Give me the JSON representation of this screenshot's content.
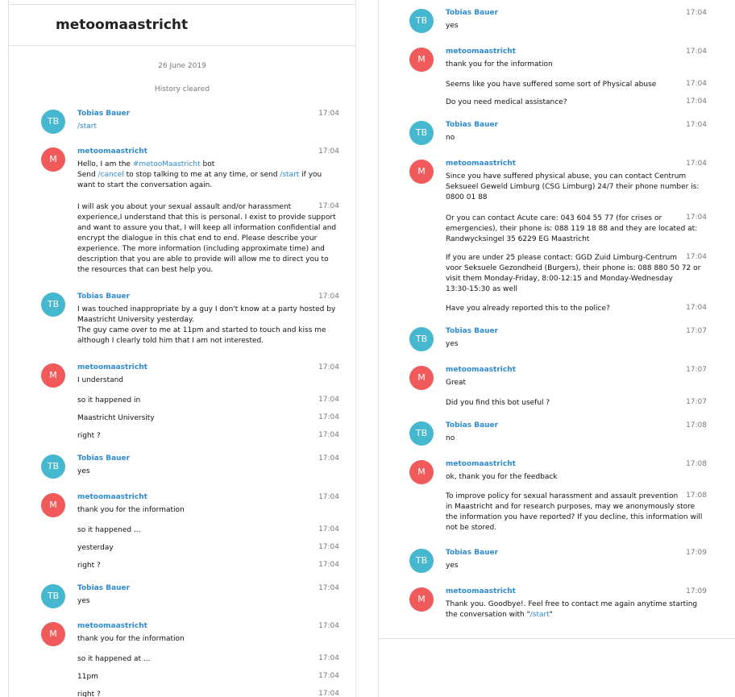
{
  "chat": {
    "title": "metoomaastricht",
    "date": "26 June 2019",
    "system_note": "History cleared"
  },
  "left": [
    {
      "sender": "Tobias Bauer",
      "avatar": "TB",
      "time": "17:04",
      "lines": [
        {
          "segments": [
            {
              "text": "/start",
              "link": true
            }
          ]
        }
      ]
    },
    {
      "sender": "metoomaastricht",
      "avatar": "M",
      "time": "17:04",
      "lines": [
        {
          "segments": [
            {
              "text": "Hello, I am the "
            },
            {
              "text": "#metooMaastricht",
              "link": true
            },
            {
              "text": " bot"
            }
          ]
        },
        {
          "segments": [
            {
              "text": "Send "
            },
            {
              "text": "/cancel",
              "link": true
            },
            {
              "text": " to stop talking to me at any time, or send "
            },
            {
              "text": "/start",
              "link": true
            },
            {
              "text": " if you"
            }
          ]
        },
        {
          "segments": [
            {
              "text": "want to start the conversation again."
            }
          ]
        }
      ]
    },
    {
      "sender": "",
      "time": "17:04",
      "lines": [
        {
          "segments": [
            {
              "text": "I will ask you about your sexual assault and/or harassment"
            }
          ]
        },
        {
          "segments": [
            {
              "text": "experience,I understand that this is personal. I exist to provide support"
            }
          ]
        },
        {
          "segments": [
            {
              "text": "and want to assure you that, I will keep all information confidential and"
            }
          ]
        },
        {
          "segments": [
            {
              "text": "encrypt the dialogue in this chat end to end. Please describe your"
            }
          ]
        },
        {
          "segments": [
            {
              "text": "experience. The more information (including approximate time) and"
            }
          ]
        },
        {
          "segments": [
            {
              "text": "description that you are able to provide will allow me to direct you to"
            }
          ]
        },
        {
          "segments": [
            {
              "text": "the resources that can best help you."
            }
          ]
        }
      ]
    },
    {
      "sender": "Tobias Bauer",
      "avatar": "TB",
      "time": "17:04",
      "lines": [
        {
          "segments": [
            {
              "text": "I was touched inappropriate by a guy I don't know at a party hosted by"
            }
          ]
        },
        {
          "segments": [
            {
              "text": "Maastricht University yesterday."
            }
          ]
        },
        {
          "segments": [
            {
              "text": "The guy came over to me at 11pm and started to touch and kiss me"
            }
          ]
        },
        {
          "segments": [
            {
              "text": "although I clearly told him that I am not interested."
            }
          ]
        }
      ]
    },
    {
      "sender": "metoomaastricht",
      "avatar": "M",
      "time": "17:04",
      "lines": [
        {
          "segments": [
            {
              "text": "I understand"
            }
          ]
        }
      ]
    },
    {
      "sender": "",
      "time": "17:04",
      "lines": [
        {
          "segments": [
            {
              "text": "so it happened in"
            }
          ]
        }
      ]
    },
    {
      "sender": "",
      "time": "17:04",
      "lines": [
        {
          "segments": [
            {
              "text": "Maastricht University"
            }
          ]
        }
      ]
    },
    {
      "sender": "",
      "time": "17:04",
      "lines": [
        {
          "segments": [
            {
              "text": "right ?"
            }
          ]
        }
      ]
    },
    {
      "sender": "Tobias Bauer",
      "avatar": "TB",
      "time": "17:04",
      "lines": [
        {
          "segments": [
            {
              "text": "yes"
            }
          ]
        }
      ]
    },
    {
      "sender": "metoomaastricht",
      "avatar": "M",
      "time": "17:04",
      "lines": [
        {
          "segments": [
            {
              "text": "thank you for the information"
            }
          ]
        }
      ]
    },
    {
      "sender": "",
      "time": "17:04",
      "lines": [
        {
          "segments": [
            {
              "text": "so it happened ..."
            }
          ]
        }
      ]
    },
    {
      "sender": "",
      "time": "17:04",
      "lines": [
        {
          "segments": [
            {
              "text": "yesterday"
            }
          ]
        }
      ]
    },
    {
      "sender": "",
      "time": "17:04",
      "lines": [
        {
          "segments": [
            {
              "text": "right ?"
            }
          ]
        }
      ]
    },
    {
      "sender": "Tobias Bauer",
      "avatar": "TB",
      "time": "17:04",
      "lines": [
        {
          "segments": [
            {
              "text": "yes"
            }
          ]
        }
      ]
    },
    {
      "sender": "metoomaastricht",
      "avatar": "M",
      "time": "17:04",
      "lines": [
        {
          "segments": [
            {
              "text": "thank you for the information"
            }
          ]
        }
      ]
    },
    {
      "sender": "",
      "time": "17:04",
      "lines": [
        {
          "segments": [
            {
              "text": "so it happened at ..."
            }
          ]
        }
      ]
    },
    {
      "sender": "",
      "time": "17:04",
      "lines": [
        {
          "segments": [
            {
              "text": "11pm"
            }
          ]
        }
      ]
    },
    {
      "sender": "",
      "time": "17:04",
      "lines": [
        {
          "segments": [
            {
              "text": "right ?"
            }
          ]
        }
      ]
    }
  ],
  "right": [
    {
      "sender": "Tobias Bauer",
      "avatar": "TB",
      "time": "17:04",
      "lines": [
        {
          "segments": [
            {
              "text": "yes"
            }
          ]
        }
      ]
    },
    {
      "sender": "metoomaastricht",
      "avatar": "M",
      "time": "17:04",
      "lines": [
        {
          "segments": [
            {
              "text": "thank you for the information"
            }
          ]
        }
      ]
    },
    {
      "sender": "",
      "time": "17:04",
      "lines": [
        {
          "segments": [
            {
              "text": "Seems like you have suffered some sort of Physical abuse"
            }
          ]
        }
      ]
    },
    {
      "sender": "",
      "time": "17:04",
      "lines": [
        {
          "segments": [
            {
              "text": "Do you need medical assistance?"
            }
          ]
        }
      ]
    },
    {
      "sender": "Tobias Bauer",
      "avatar": "TB",
      "time": "17:04",
      "lines": [
        {
          "segments": [
            {
              "text": "no"
            }
          ]
        }
      ]
    },
    {
      "sender": "metoomaastricht",
      "avatar": "M",
      "time": "17:04",
      "lines": [
        {
          "segments": [
            {
              "text": "Since you have suffered physical abuse, you can contact Centrum"
            }
          ]
        },
        {
          "segments": [
            {
              "text": "Seksueel Geweld Limburg (CSG Limburg) 24/7 their phone number is:"
            }
          ]
        },
        {
          "segments": [
            {
              "text": "0800 01 88"
            }
          ]
        }
      ]
    },
    {
      "sender": "",
      "time": "17:04",
      "lines": [
        {
          "segments": [
            {
              "text": "Or you can contact Acute care: 043 604 55 77 (for crises or"
            }
          ]
        },
        {
          "segments": [
            {
              "text": "emergencies), their phone is: 088 119 18 88 and they are located at:"
            }
          ]
        },
        {
          "segments": [
            {
              "text": "Randwycksingel 35 6229 EG Maastricht"
            }
          ]
        }
      ]
    },
    {
      "sender": "",
      "time": "17:04",
      "lines": [
        {
          "segments": [
            {
              "text": "If you are under 25 please contact: GGD Zuid Limburg-Centrum"
            }
          ]
        },
        {
          "segments": [
            {
              "text": "voor Seksuele Gezondheid (Burgers), their phone is: 088 880 50 72 or"
            }
          ]
        },
        {
          "segments": [
            {
              "text": "visit them Monday-Friday, 8:00-12:15 and Monday-Wednesday"
            }
          ]
        },
        {
          "segments": [
            {
              "text": "13:30-15:30 as well"
            }
          ]
        }
      ]
    },
    {
      "sender": "",
      "time": "17:04",
      "lines": [
        {
          "segments": [
            {
              "text": "Have you already reported this to the police?"
            }
          ]
        }
      ]
    },
    {
      "sender": "Tobias Bauer",
      "avatar": "TB",
      "time": "17:07",
      "lines": [
        {
          "segments": [
            {
              "text": "yes"
            }
          ]
        }
      ]
    },
    {
      "sender": "metoomaastricht",
      "avatar": "M",
      "time": "17:07",
      "lines": [
        {
          "segments": [
            {
              "text": "Great"
            }
          ]
        }
      ]
    },
    {
      "sender": "",
      "time": "17:07",
      "lines": [
        {
          "segments": [
            {
              "text": "Did you find this bot useful ?"
            }
          ]
        }
      ]
    },
    {
      "sender": "Tobias Bauer",
      "avatar": "TB",
      "time": "17:08",
      "lines": [
        {
          "segments": [
            {
              "text": "no"
            }
          ]
        }
      ]
    },
    {
      "sender": "metoomaastricht",
      "avatar": "M",
      "time": "17:08",
      "lines": [
        {
          "segments": [
            {
              "text": "ok, thank you for the feedback"
            }
          ]
        }
      ]
    },
    {
      "sender": "",
      "time": "17:08",
      "lines": [
        {
          "segments": [
            {
              "text": "To improve policy for sexual harassment and assault prevention"
            }
          ]
        },
        {
          "segments": [
            {
              "text": "in Maastricht and for research purposes, may we anonymously store"
            }
          ]
        },
        {
          "segments": [
            {
              "text": "the information you have reported? If you decline, this information will"
            }
          ]
        },
        {
          "segments": [
            {
              "text": "not be stored."
            }
          ]
        }
      ]
    },
    {
      "sender": "Tobias Bauer",
      "avatar": "TB",
      "time": "17:09",
      "lines": [
        {
          "segments": [
            {
              "text": "yes"
            }
          ]
        }
      ]
    },
    {
      "sender": "metoomaastricht",
      "avatar": "M",
      "time": "17:09",
      "lines": [
        {
          "segments": [
            {
              "text": "Thank you. Goodbye!. Feel free to contact me again anytime starting"
            }
          ]
        },
        {
          "segments": [
            {
              "text": "the conversation with \""
            },
            {
              "text": "/start",
              "link": true
            },
            {
              "text": "\""
            }
          ]
        }
      ]
    }
  ]
}
